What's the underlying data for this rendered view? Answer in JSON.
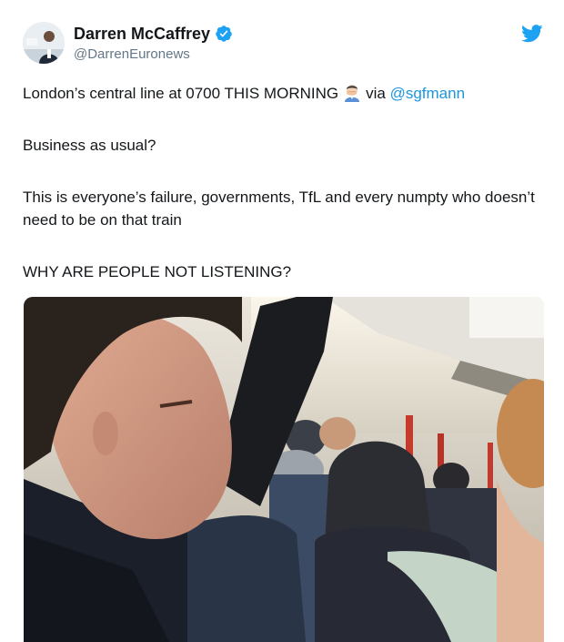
{
  "author": {
    "display_name": "Darren McCaffrey",
    "handle": "@DarrenEuronews",
    "verified": true,
    "avatar_icon": "profile-photo"
  },
  "tweet": {
    "line1_before": "London’s central line at 0700 THIS MORNING",
    "line1_via": "via",
    "line1_mention": "@sgfmann",
    "line2": "Business as usual?",
    "line3": "This is everyone’s failure, governments, TfL and every numpty who doesn’t need to be on that train",
    "line4": "WHY ARE PEOPLE NOT LISTENING?",
    "emoji": "man-facepalming-emoji"
  },
  "brand": {
    "twitter_blue": "#1da1f2",
    "link_color": "#1b95e0",
    "verified_color": "#1da1f2"
  },
  "media": {
    "description_icon": "crowded-train-photo"
  }
}
